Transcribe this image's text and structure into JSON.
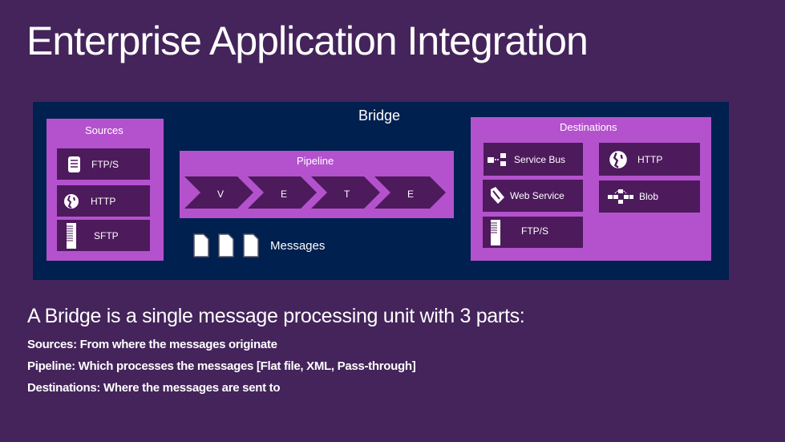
{
  "title": "Enterprise Application Integration",
  "colors": {
    "background": "#44245a",
    "bridge": "#002050",
    "panel": "#b452cd",
    "tile": "#4d1a5c",
    "text": "#ffffff"
  },
  "bridge": {
    "label": "Bridge",
    "sources": {
      "label": "Sources",
      "items": [
        {
          "label": "FTP/S",
          "icon": "database-icon"
        },
        {
          "label": "HTTP",
          "icon": "globe-icon"
        },
        {
          "label": "SFTP",
          "icon": "server-icon"
        }
      ]
    },
    "pipeline": {
      "label": "Pipeline",
      "stages": [
        "V",
        "E",
        "T",
        "E"
      ]
    },
    "messages": {
      "label": "Messages",
      "count": 3
    },
    "destinations": {
      "label": "Destinations",
      "items": [
        {
          "label": "Service Bus",
          "icon": "service-bus-icon"
        },
        {
          "label": "HTTP",
          "icon": "globe-icon"
        },
        {
          "label": "Web Service",
          "icon": "web-service-icon"
        },
        {
          "label": "Blob",
          "icon": "blob-icon"
        },
        {
          "label": "FTP/S",
          "icon": "server-icon"
        }
      ]
    }
  },
  "description": {
    "heading": "A Bridge is a single message processing unit with 3 parts:",
    "bullets": [
      "Sources: From where the messages originate",
      "Pipeline: Which processes the messages [Flat file, XML, Pass-through]",
      "Destinations: Where the messages are sent to"
    ]
  }
}
